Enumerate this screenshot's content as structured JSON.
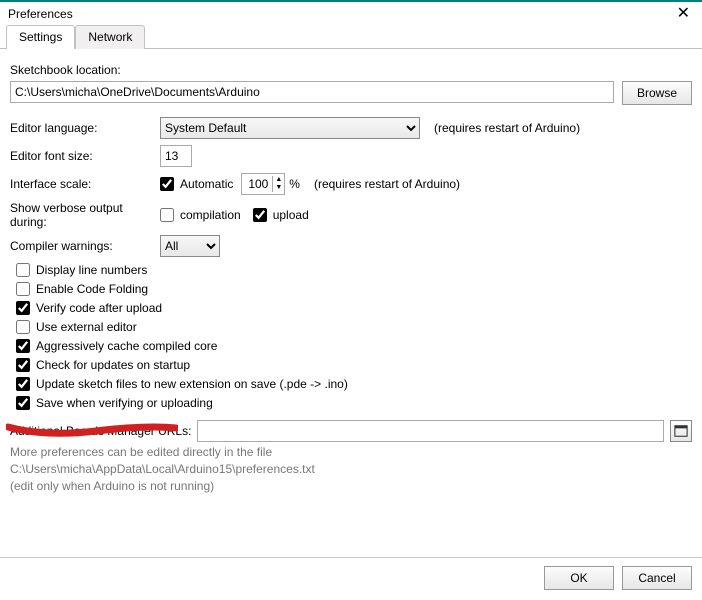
{
  "window": {
    "title": "Preferences"
  },
  "tabs": {
    "settings": "Settings",
    "network": "Network"
  },
  "sketchbook": {
    "label": "Sketchbook location:",
    "path": "C:\\Users\\micha\\OneDrive\\Documents\\Arduino",
    "browse": "Browse"
  },
  "language": {
    "label": "Editor language:",
    "value": "System Default",
    "note": "(requires restart of Arduino)"
  },
  "fontsize": {
    "label": "Editor font size:",
    "value": "13"
  },
  "scale": {
    "label": "Interface scale:",
    "automatic": "Automatic",
    "value": "100",
    "percent": "%",
    "note": "(requires restart of Arduino)"
  },
  "verbose": {
    "label": "Show verbose output during:",
    "compilation": "compilation",
    "upload": "upload"
  },
  "warnings": {
    "label": "Compiler warnings:",
    "value": "All"
  },
  "checks": {
    "line_numbers": "Display line numbers",
    "code_folding": "Enable Code Folding",
    "verify_upload": "Verify code after upload",
    "external_editor": "Use external editor",
    "cache_core": "Aggressively cache compiled core",
    "check_updates": "Check for updates on startup",
    "update_ext": "Update sketch files to new extension on save (.pde -> .ino)",
    "save_verify": "Save when verifying or uploading"
  },
  "boards_url": {
    "label": "Additional Boards Manager URLs:",
    "value": ""
  },
  "more": {
    "line1": "More preferences can be edited directly in the file",
    "line2": "C:\\Users\\micha\\AppData\\Local\\Arduino15\\preferences.txt",
    "line3": "(edit only when Arduino is not running)"
  },
  "footer": {
    "ok": "OK",
    "cancel": "Cancel"
  }
}
